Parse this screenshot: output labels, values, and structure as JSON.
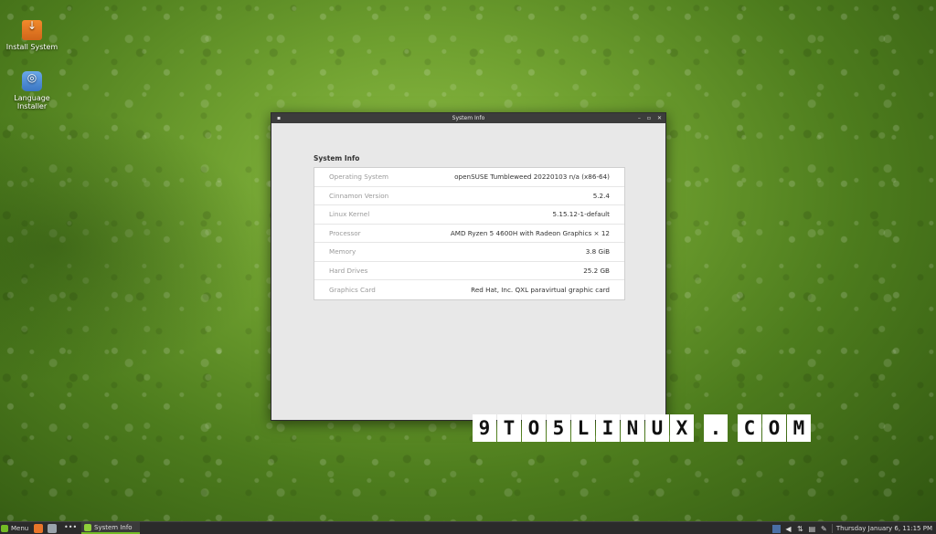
{
  "desktop": {
    "icons": [
      {
        "label": "Install System"
      },
      {
        "label": "Language\nInstaller"
      }
    ]
  },
  "window": {
    "title": "System Info",
    "heading": "System Info",
    "rows": [
      {
        "key": "Operating System",
        "value": "openSUSE Tumbleweed 20220103 n/a (x86-64)"
      },
      {
        "key": "Cinnamon Version",
        "value": "5.2.4"
      },
      {
        "key": "Linux Kernel",
        "value": "5.15.12-1-default"
      },
      {
        "key": "Processor",
        "value": "AMD Ryzen 5 4600H with Radeon Graphics × 12"
      },
      {
        "key": "Memory",
        "value": "3.8 GiB"
      },
      {
        "key": "Hard Drives",
        "value": "25.2 GB"
      },
      {
        "key": "Graphics Card",
        "value": "Red Hat, Inc. QXL paravirtual graphic card"
      }
    ]
  },
  "watermark": {
    "letters": [
      "9",
      "T",
      "O",
      "5",
      "L",
      "I",
      "N",
      "U",
      "X",
      ".",
      "C",
      "O",
      "M"
    ]
  },
  "taskbar": {
    "menu_label": "Menu",
    "task_label": "System Info",
    "clock": "Thursday January  6, 11:15 PM"
  }
}
